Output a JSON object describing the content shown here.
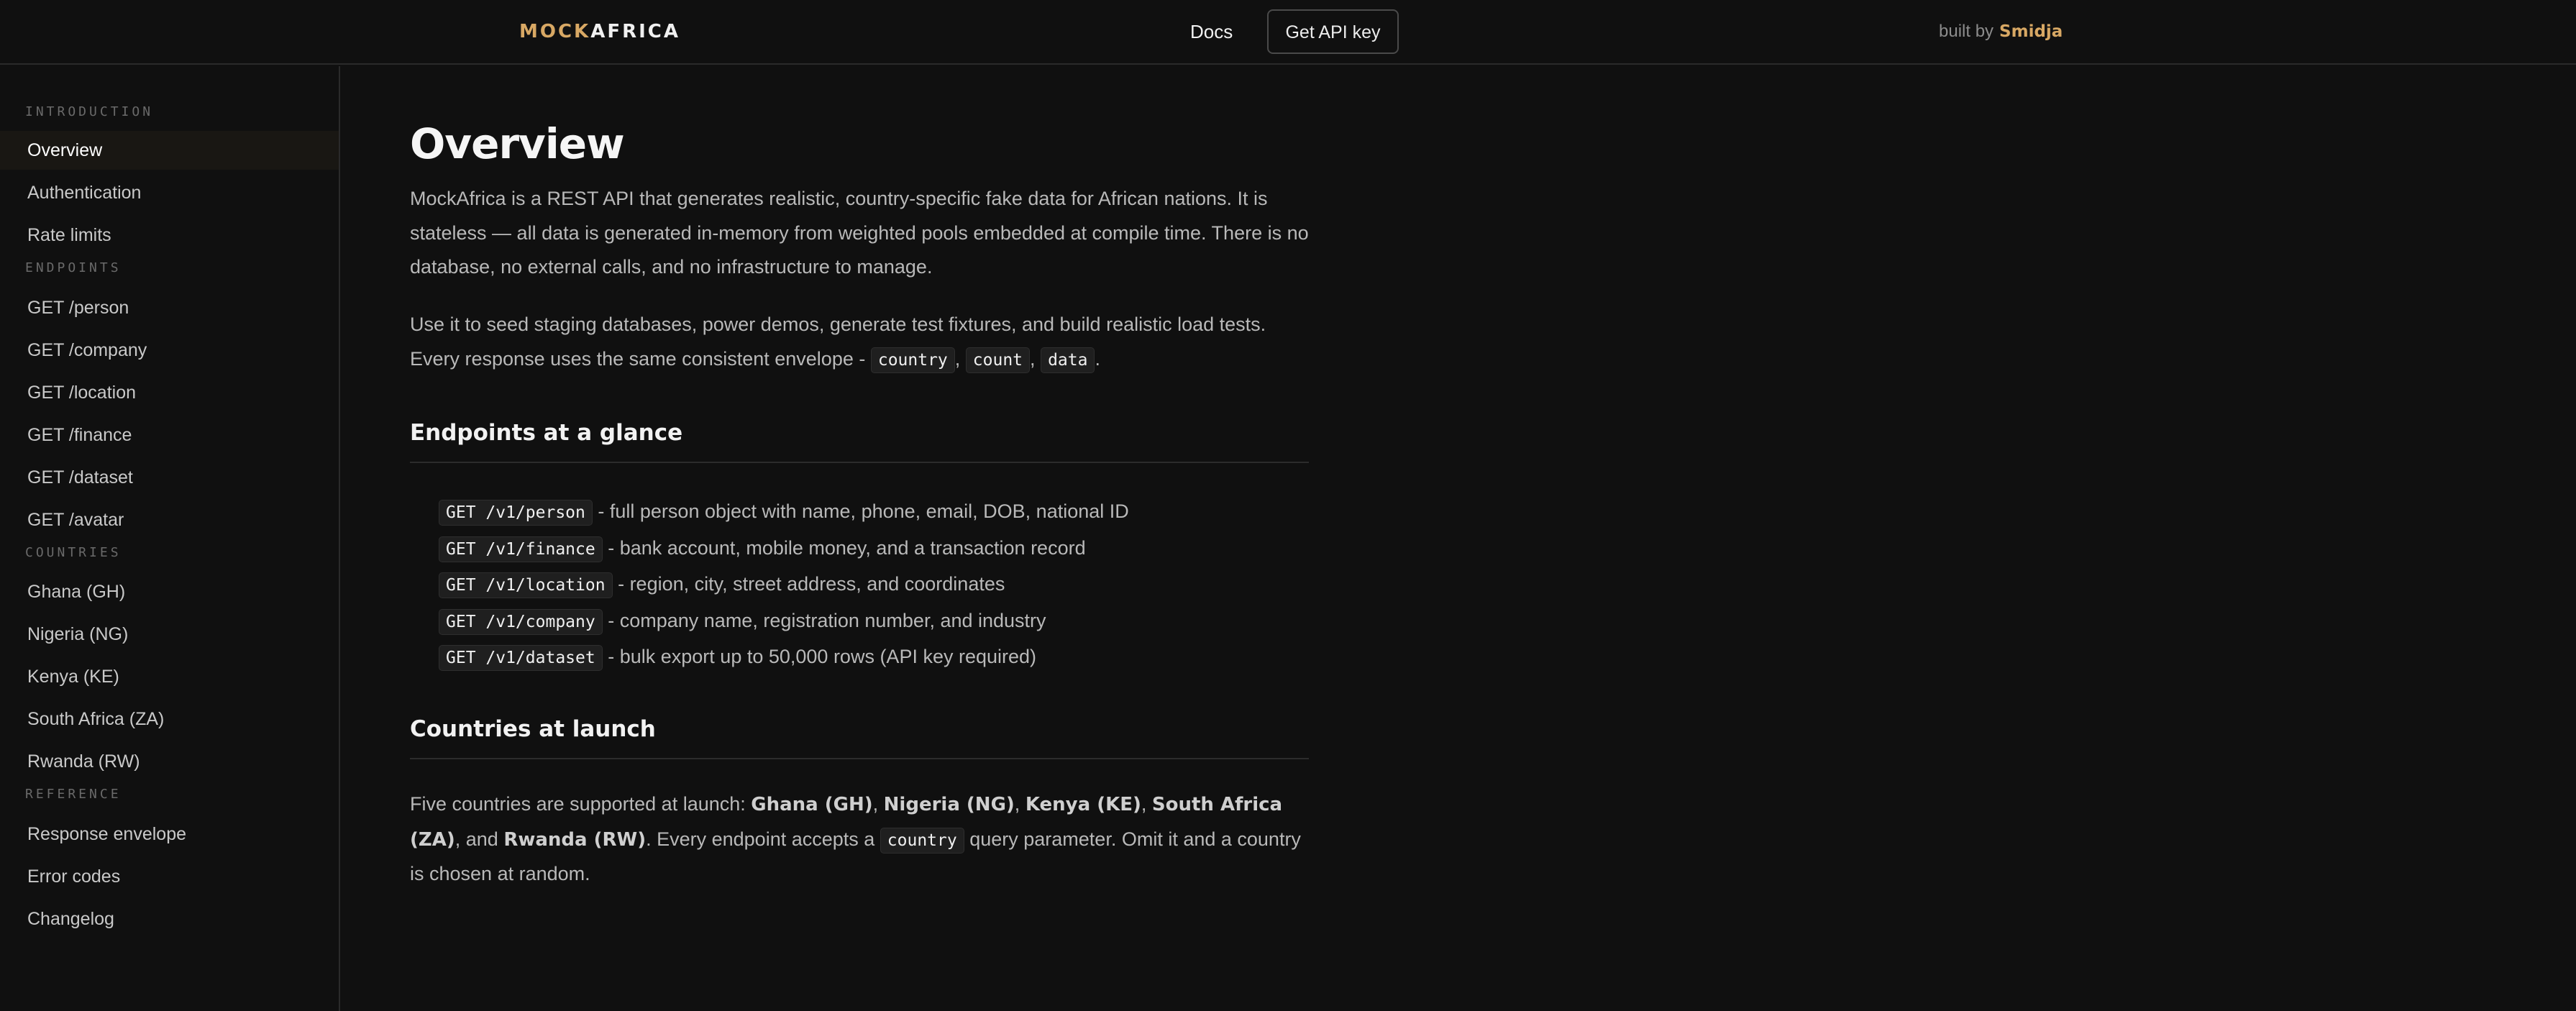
{
  "header": {
    "logo_mock": "MOCK",
    "logo_africa": "AFRICA",
    "docs_label": "Docs",
    "api_key_label": "Get API key",
    "built_by_label": "built by",
    "author": "Smidja"
  },
  "sidebar": {
    "sections": [
      {
        "label": "INTRODUCTION",
        "items": [
          "Overview",
          "Authentication",
          "Rate limits"
        ]
      },
      {
        "label": "ENDPOINTS",
        "items": [
          "GET /person",
          "GET /company",
          "GET /location",
          "GET /finance",
          "GET /dataset",
          "GET /avatar"
        ]
      },
      {
        "label": "COUNTRIES",
        "items": [
          "Ghana (GH)",
          "Nigeria (NG)",
          "Kenya (KE)",
          "South Africa (ZA)",
          "Rwanda (RW)"
        ]
      },
      {
        "label": "REFERENCE",
        "items": [
          "Response envelope",
          "Error codes",
          "Changelog"
        ]
      }
    ],
    "active_item": "Overview"
  },
  "main": {
    "title": "Overview",
    "intro_paragraph": "MockAfrica is a REST API that generates realistic, country-specific fake data for African nations. It is stateless — all data is generated in-memory from weighted pools embedded at compile time. There is no database, no external calls, and no infrastructure to manage.",
    "usage_paragraph_prefix": "Use it to seed staging databases, power demos, generate test fixtures, and build realistic load tests. Every response uses the same consistent envelope - ",
    "envelope_fields": [
      "country",
      "count",
      "data"
    ],
    "endpoints_heading": "Endpoints at a glance",
    "endpoints": [
      {
        "code": "GET /v1/person",
        "desc": "- full person object with name, phone, email, DOB, national ID"
      },
      {
        "code": "GET /v1/finance",
        "desc": "- bank account, mobile money, and a transaction record"
      },
      {
        "code": "GET /v1/location",
        "desc": "- region, city, street address, and coordinates"
      },
      {
        "code": "GET /v1/company",
        "desc": "- company name, registration number, and industry"
      },
      {
        "code": "GET /v1/dataset",
        "desc": "- bulk export up to 50,000 rows (API key required)"
      }
    ],
    "countries_heading": "Countries at launch",
    "countries_text": {
      "prefix": "Five countries are supported at launch: ",
      "ghana": "Ghana (GH)",
      "nigeria": "Nigeria (NG)",
      "kenya": "Kenya (KE)",
      "south_africa": "South Africa (ZA)",
      "rwanda": "Rwanda (RW)",
      "sep": ", ",
      "and": ", and ",
      "middle": ". Every endpoint accepts a ",
      "param": "country",
      "suffix": " query parameter. Omit it and a country is chosen at random."
    }
  }
}
